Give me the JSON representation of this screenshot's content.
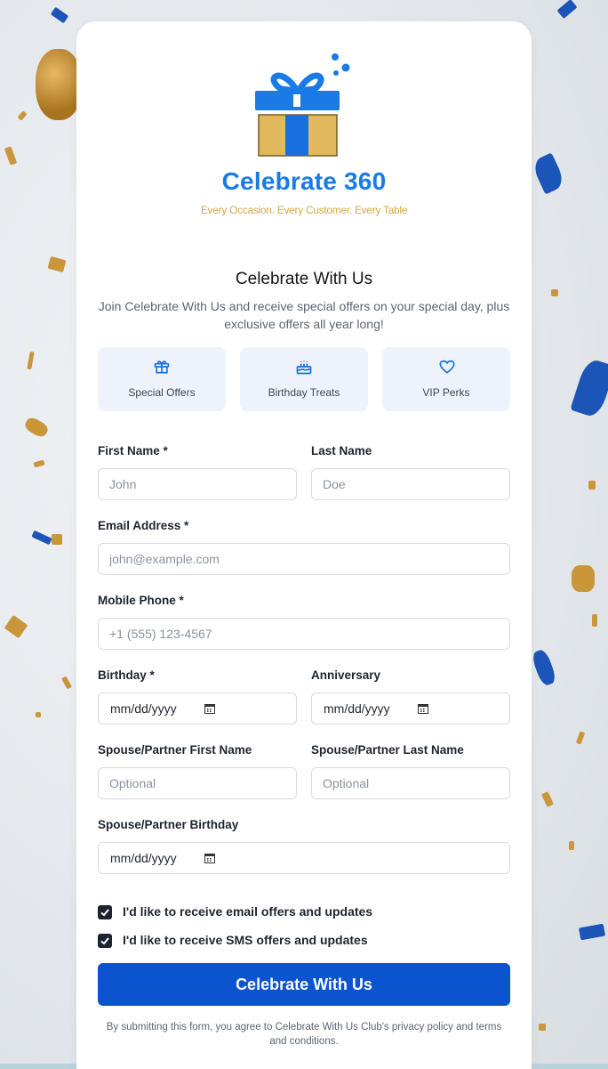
{
  "brand": {
    "name": "Celebrate 360",
    "tagline": "Every Occasion. Every Customer. Every Table",
    "primary_color": "#1a7ae6",
    "gold_color": "#d6a84a"
  },
  "heading": {
    "title": "Celebrate With Us",
    "subtitle": "Join Celebrate With Us and receive special offers on your special day, plus exclusive offers all year long!"
  },
  "perks": [
    {
      "icon": "gift-icon",
      "label": "Special Offers"
    },
    {
      "icon": "cake-icon",
      "label": "Birthday Treats"
    },
    {
      "icon": "heart-icon",
      "label": "VIP Perks"
    }
  ],
  "form": {
    "first_name": {
      "label": "First Name *",
      "placeholder": "John"
    },
    "last_name": {
      "label": "Last Name",
      "placeholder": "Doe"
    },
    "email": {
      "label": "Email Address *",
      "placeholder": "john@example.com"
    },
    "phone": {
      "label": "Mobile Phone *",
      "placeholder": "+1 (555) 123-4567"
    },
    "birthday": {
      "label": "Birthday *",
      "value": "mm/dd/yyyy"
    },
    "anniversary": {
      "label": "Anniversary",
      "value": "mm/dd/yyyy"
    },
    "spouse_first": {
      "label": "Spouse/Partner First Name",
      "placeholder": "Optional"
    },
    "spouse_last": {
      "label": "Spouse/Partner Last Name",
      "placeholder": "Optional"
    },
    "spouse_birthday": {
      "label": "Spouse/Partner Birthday",
      "value": "mm/dd/yyyy"
    },
    "email_optin": {
      "label": "I'd like to receive email offers and updates",
      "checked": true
    },
    "sms_optin": {
      "label": "I'd like to receive SMS offers and updates",
      "checked": true
    },
    "submit_label": "Celebrate With Us",
    "legal": "By submitting this form, you agree to Celebrate With Us Club's privacy policy and terms and conditions."
  },
  "colors": {
    "submit_bg": "#0b53cf",
    "perk_bg": "#eef3fb",
    "accent_blue": "#1a6fe0"
  }
}
